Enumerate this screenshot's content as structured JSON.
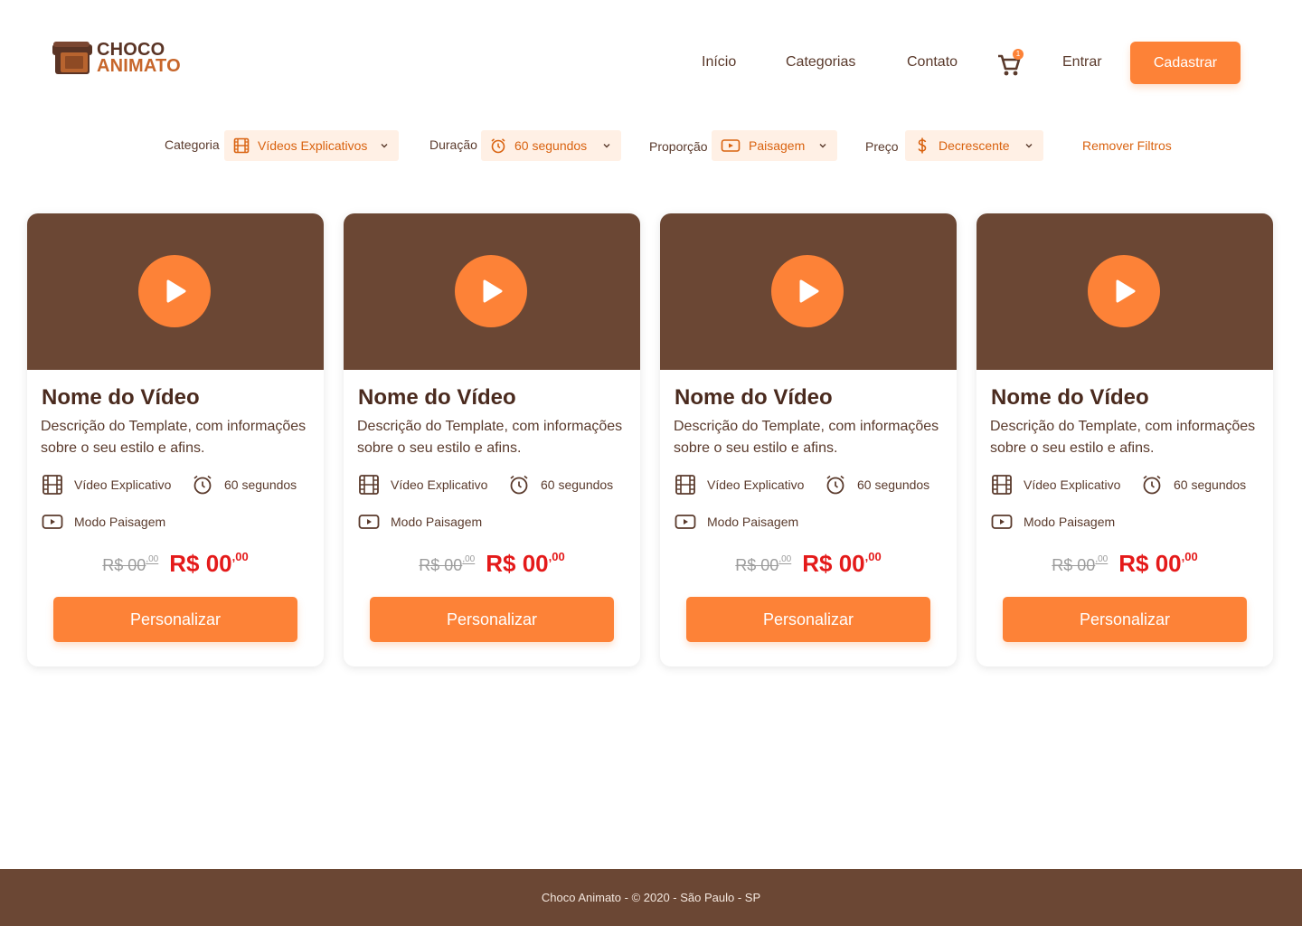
{
  "brand": {
    "line1": "CHOCO",
    "line2": "ANIMATO"
  },
  "nav": {
    "home": "Início",
    "categories": "Categorias",
    "contact": "Contato",
    "cart_count": "1",
    "login": "Entrar",
    "signup": "Cadastrar"
  },
  "filters": {
    "category": {
      "label": "Categoria",
      "value": "Vídeos Explicativos",
      "icon": "film-icon"
    },
    "duration": {
      "label": "Duração",
      "value": "60 segundos",
      "icon": "alarm-clock-icon"
    },
    "ratio": {
      "label": "Proporção",
      "value": "Paisagem",
      "icon": "video-frame-icon"
    },
    "price": {
      "label": "Preço",
      "value": "Decrescente",
      "icon": "dollar-icon"
    },
    "remove": "Remover Filtros"
  },
  "cards": [
    {
      "title": "Nome do Vídeo",
      "description": "Descrição do Template, com informações sobre o seu estilo e afins.",
      "type": "Vídeo Explicativo",
      "duration": "60 segundos",
      "mode": "Modo Paisagem",
      "old_price": "R$ 00",
      "old_cents": ",00",
      "new_price": "R$ 00",
      "new_cents": ",00",
      "button": "Personalizar"
    },
    {
      "title": "Nome do Vídeo",
      "description": "Descrição do Template, com informações sobre o seu estilo e afins.",
      "type": "Vídeo Explicativo",
      "duration": "60 segundos",
      "mode": "Modo Paisagem",
      "old_price": "R$ 00",
      "old_cents": ",00",
      "new_price": "R$ 00",
      "new_cents": ",00",
      "button": "Personalizar"
    },
    {
      "title": "Nome do Vídeo",
      "description": "Descrição do Template, com informações sobre o seu estilo e afins.",
      "type": "Vídeo Explicativo",
      "duration": "60 segundos",
      "mode": "Modo Paisagem",
      "old_price": "R$ 00",
      "old_cents": ",00",
      "new_price": "R$ 00",
      "new_cents": ",00",
      "button": "Personalizar"
    },
    {
      "title": "Nome do Vídeo",
      "description": "Descrição do Template, com informações sobre o seu estilo e afins.",
      "type": "Vídeo Explicativo",
      "duration": "60 segundos",
      "mode": "Modo Paisagem",
      "old_price": "R$ 00",
      "old_cents": ",00",
      "new_price": "R$ 00",
      "new_cents": ",00",
      "button": "Personalizar"
    }
  ],
  "footer": {
    "text": "Choco Animato - © 2020 - São Paulo - SP"
  },
  "colors": {
    "accent": "#fd8237",
    "brown": "#6b4734",
    "price_red": "#e41a1a",
    "filter_bg": "#fff0e5"
  }
}
